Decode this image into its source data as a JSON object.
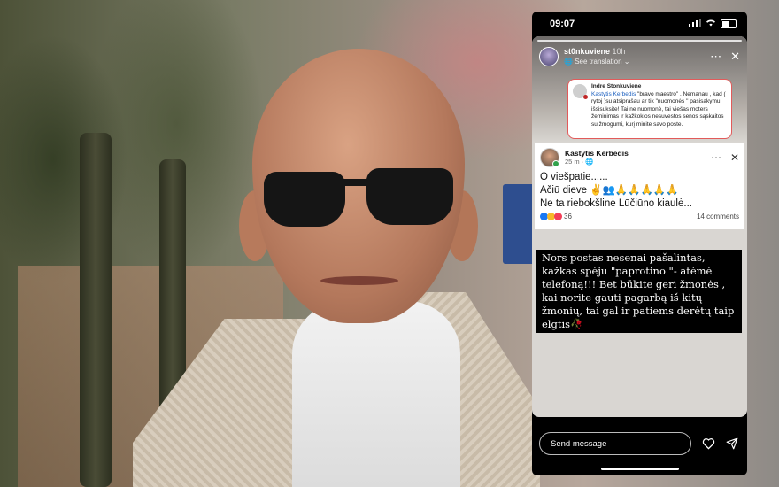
{
  "status_bar": {
    "time": "09:07"
  },
  "story": {
    "username": "st0nkuviene",
    "time_ago": "10h",
    "see_translation": "See translation"
  },
  "comment": {
    "name": "Indre Stonkuviene",
    "mention": "Kastytis Kerbedis",
    "text": "\"bravo maestro\"   . Nemanau , kad ( rytoj )su atsiprašau ar tik \"nuomonės \" pasisakymu išsisuksite! Tai ne nuomonė, tai viešas moters žeminimas ir kažkokios nesuvestos senos sąskaitos su žmogumi, kurį minite savo poste."
  },
  "post": {
    "author": "Kastytis Kerbedis",
    "time": "25 m",
    "line1": "O viešpatie......",
    "line2": "Ačiū dieve ✌️👥🙏🙏🙏🙏🙏",
    "line3": "Ne ta riebokšlinė Lūčiūno  kiaulė...",
    "reaction_count": "36",
    "comments": "14 comments"
  },
  "caption": "Nors postas nesenai pašalintas, kažkas spėju \"paprotino \"- atėmė telefoną!!! Bet būkite geri žmonės , kai norite gauti pagarbą iš kitų žmonių, tai gal ir patiems derėtų taip elgtis🥀",
  "bottom_bar": {
    "send_placeholder": "Send message"
  },
  "icons": [
    "wifi-icon",
    "signal-icon",
    "battery-icon",
    "more-icon",
    "close-icon",
    "heart-icon",
    "send-icon"
  ],
  "colors": {
    "facebook_blue": "#1877f2",
    "comment_border": "#e25a5a",
    "caption_bg": "#000000"
  }
}
